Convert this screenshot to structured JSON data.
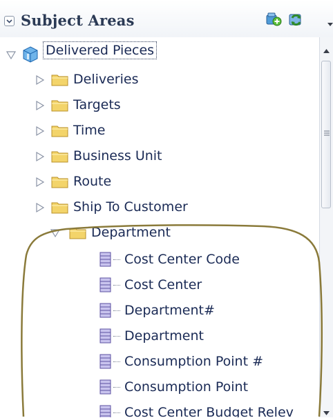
{
  "header": {
    "title": "Subject Areas",
    "collapse_icon": "chevron-collapse-icon",
    "add_icon": "add-subject-area-icon",
    "refresh_icon": "refresh-icon",
    "menu_icon": "dropdown-arrow-icon"
  },
  "tree": {
    "root": {
      "label": "Delivered Pieces",
      "expanded": true,
      "selected": true
    },
    "folders": [
      {
        "label": "Deliveries",
        "expanded": false
      },
      {
        "label": "Targets",
        "expanded": false
      },
      {
        "label": "Time",
        "expanded": false
      },
      {
        "label": "Business Unit",
        "expanded": false
      },
      {
        "label": "Route",
        "expanded": false
      },
      {
        "label": "Ship To Customer",
        "expanded": false
      },
      {
        "label": "Department",
        "expanded": true
      }
    ],
    "columns": [
      {
        "label": "Cost Center Code"
      },
      {
        "label": "Cost Center"
      },
      {
        "label": "Department#"
      },
      {
        "label": "Department"
      },
      {
        "label": "Consumption Point #"
      },
      {
        "label": "Consumption Point"
      },
      {
        "label": "Cost Center Budget Relev"
      }
    ]
  },
  "colors": {
    "folder": "#f3d46a",
    "column_icon": "#6a5fa8",
    "highlight_outline": "#8a7a3a",
    "root_icon": "#2f8fd8"
  },
  "scrollbar": {
    "position_fraction": 0.0
  }
}
